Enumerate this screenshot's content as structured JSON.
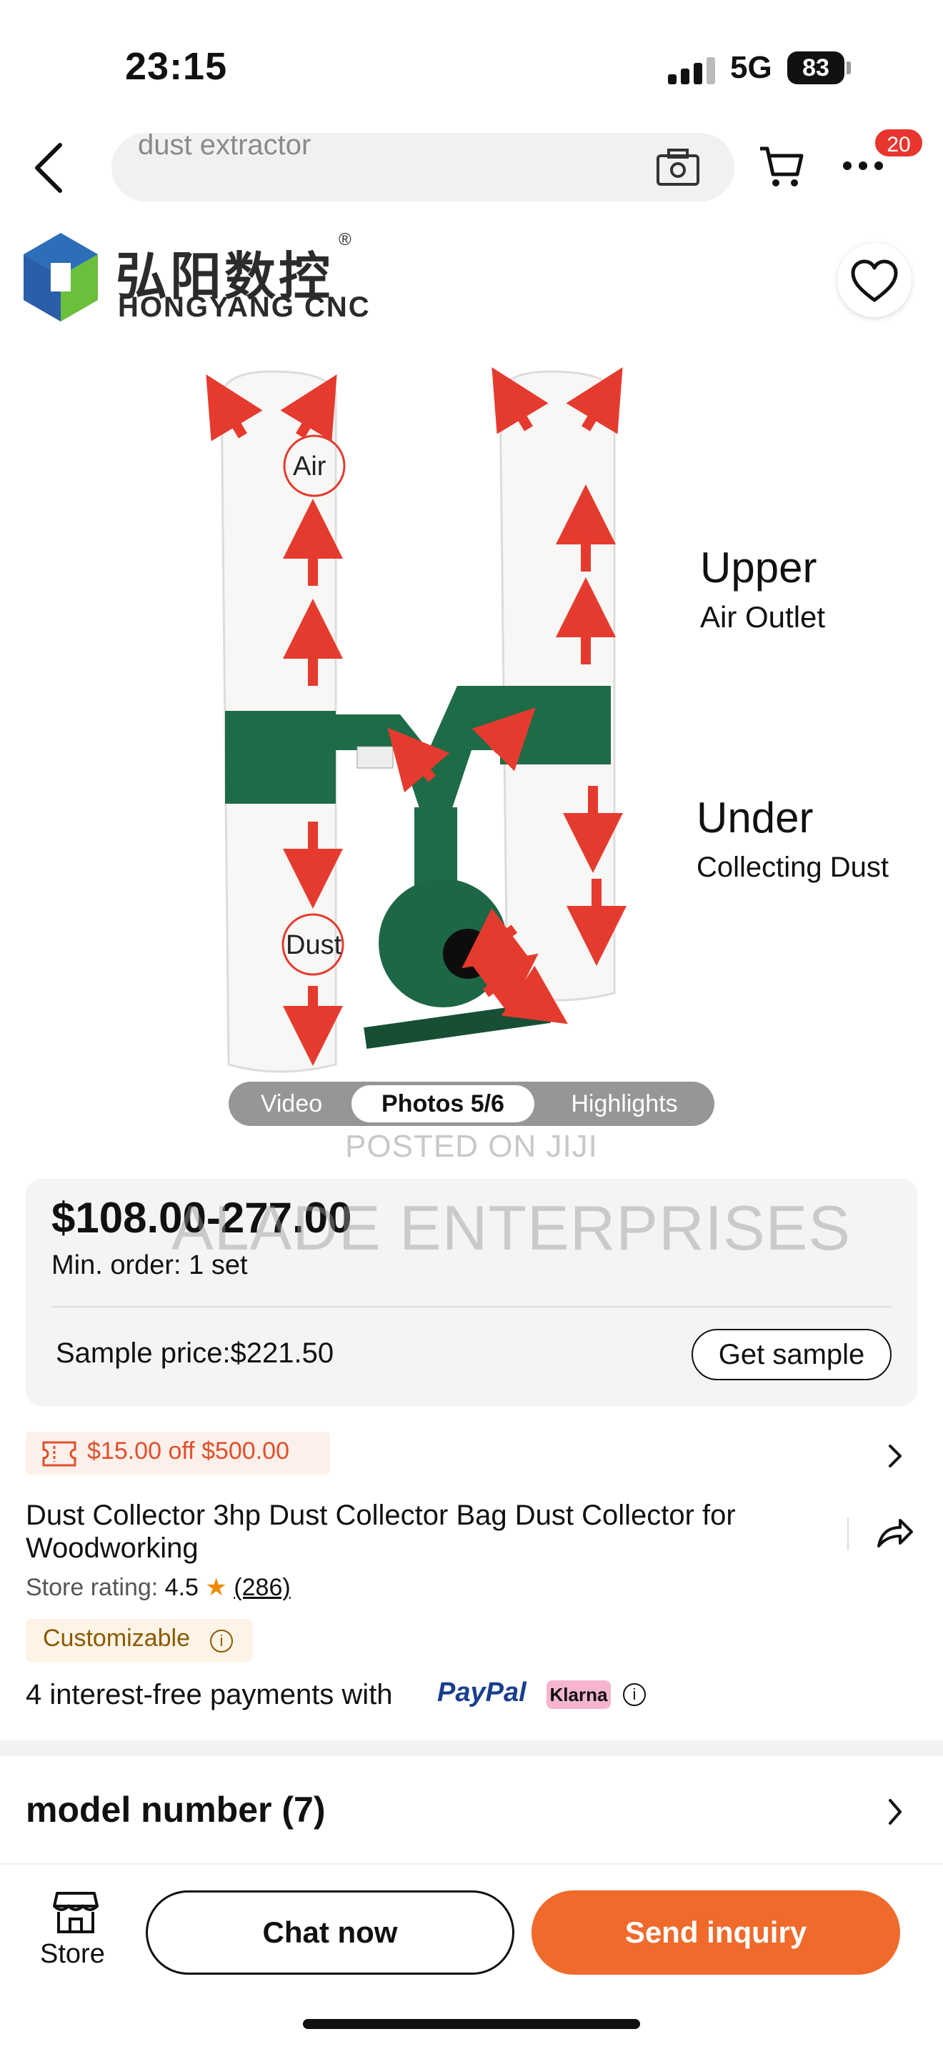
{
  "status_bar": {
    "time": "23:15",
    "network": "5G",
    "battery": "83"
  },
  "nav": {
    "search_value": "dust extractor",
    "cart_badge": "20"
  },
  "gallery": {
    "brand_cn": "弘阳数控",
    "brand_en": "HONGYANG CNC",
    "brand_reg": "®",
    "bag_labels": {
      "air": "Air",
      "dust": "Dust"
    },
    "annotations": {
      "upper": "Upper",
      "upper_sub": "Air Outlet",
      "under": "Under",
      "under_sub": "Collecting Dust"
    },
    "tabs": [
      {
        "label": "Video"
      },
      {
        "label": "Photos 5/6",
        "active": true
      },
      {
        "label": "Highlights"
      }
    ],
    "watermark_1": "POSTED ON JIJI"
  },
  "price_card": {
    "price": "$108.00-277.00",
    "watermark_2": "ALADE ENTERPRISES",
    "min_order": "Min. order: 1 set",
    "sample_price": "Sample price:$221.50",
    "get_sample_label": "Get sample"
  },
  "coupon": {
    "text": "$15.00 off $500.00"
  },
  "product": {
    "title": "Dust Collector 3hp Dust Collector Bag Dust Collector for Woodworking",
    "rating_label": "Store rating:",
    "rating_value": "4.5",
    "rating_star": "★",
    "rating_count": "(286)",
    "customizable": "Customizable",
    "payments_text": "4 interest-free payments with",
    "paypal": "PayPal",
    "klarna": "Klarna"
  },
  "model_section": {
    "label": "model number (7)"
  },
  "bottom_bar": {
    "store_label": "Store",
    "chat_label": "Chat now",
    "inquiry_label": "Send inquiry"
  },
  "colors": {
    "accent": "#ef6a2b",
    "badge": "#e8362e",
    "machine_green": "#1e6b47",
    "arrow_red": "#e53b2f"
  }
}
